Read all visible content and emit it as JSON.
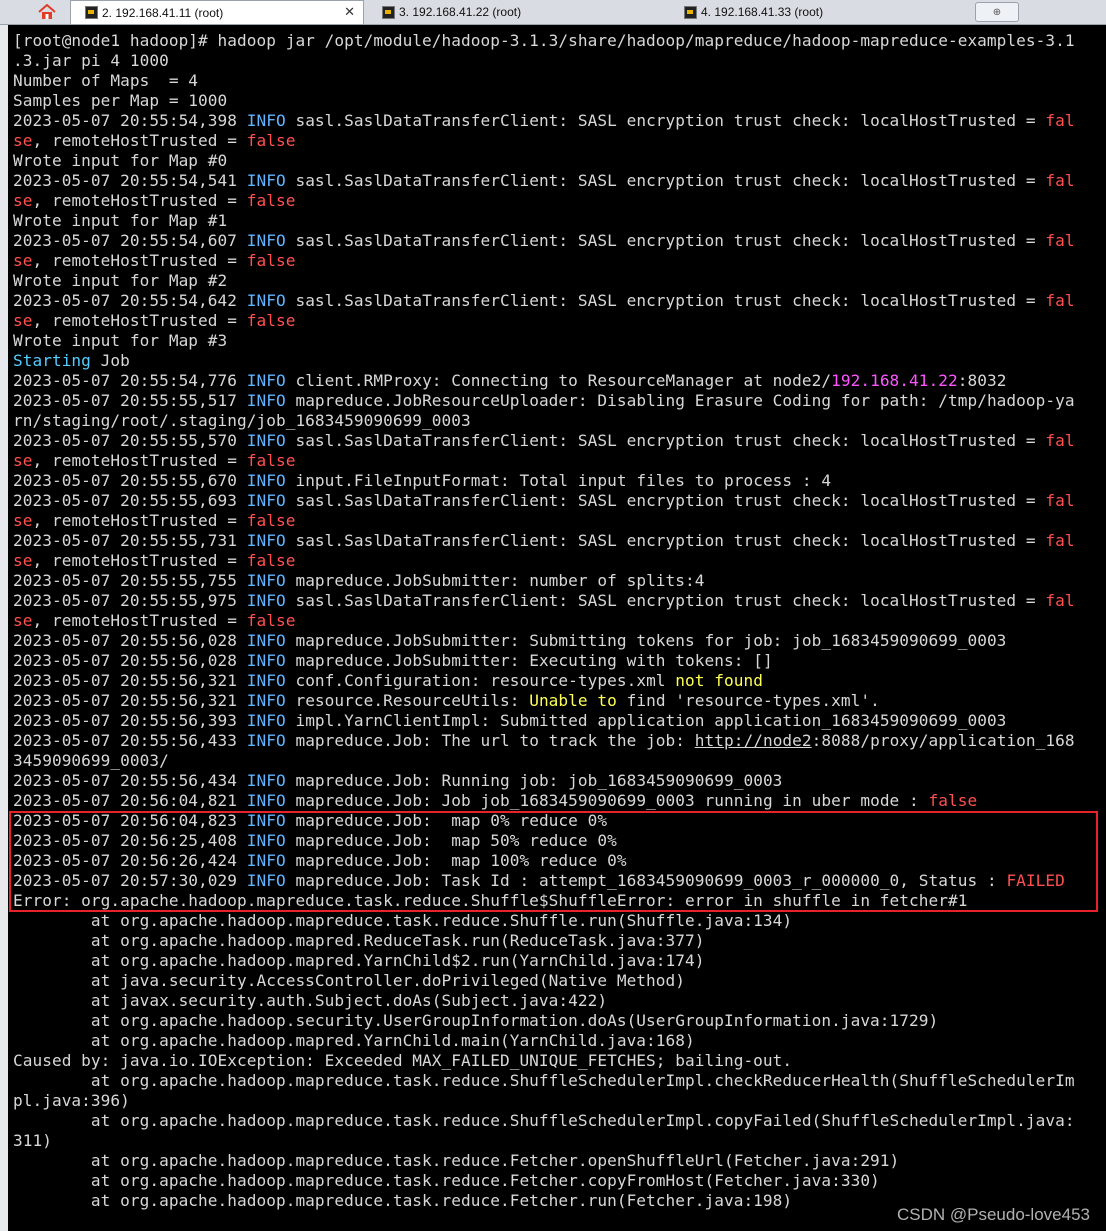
{
  "tabs": [
    {
      "label": "2. 192.168.41.11 (root)",
      "active": true,
      "closable": true
    },
    {
      "label": "3. 192.168.41.22 (root)",
      "active": false,
      "closable": false
    },
    {
      "label": "4. 192.168.41.33 (root)",
      "active": false,
      "closable": false
    }
  ],
  "icons": {
    "home": "home-icon",
    "new_tab": "new-tab-icon",
    "tab": "terminal-tab-icon"
  },
  "colors": {
    "background": "#000000",
    "text": "#d8d8d8",
    "info": "#5fb3ff",
    "false": "#ff4f4f",
    "ip": "#ff55ff",
    "warning": "#ffff55",
    "highlight_box": "#e8222a"
  },
  "terminal_lines": [
    [
      {
        "t": "[root@node1 hadoop]# hadoop jar /opt/module/hadoop-3.1.3/share/hadoop/mapreduce/hadoop-mapreduce-examples-3.1"
      }
    ],
    [
      {
        "t": ".3.jar pi 4 1000"
      }
    ],
    [
      {
        "t": "Number of Maps  = 4"
      }
    ],
    [
      {
        "t": "Samples per Map = 1000"
      }
    ],
    [
      {
        "t": "2023-05-07 20:55:54,398 "
      },
      {
        "t": "INFO",
        "c": "info"
      },
      {
        "t": " sasl.SaslDataTransferClient: SASL encryption trust check: localHostTrusted = "
      },
      {
        "t": "fal",
        "c": "red"
      }
    ],
    [
      {
        "t": "se",
        "c": "red"
      },
      {
        "t": ", remoteHostTrusted = "
      },
      {
        "t": "false",
        "c": "red"
      }
    ],
    [
      {
        "t": "Wrote input for Map #0"
      }
    ],
    [
      {
        "t": "2023-05-07 20:55:54,541 "
      },
      {
        "t": "INFO",
        "c": "info"
      },
      {
        "t": " sasl.SaslDataTransferClient: SASL encryption trust check: localHostTrusted = "
      },
      {
        "t": "fal",
        "c": "red"
      }
    ],
    [
      {
        "t": "se",
        "c": "red"
      },
      {
        "t": ", remoteHostTrusted = "
      },
      {
        "t": "false",
        "c": "red"
      }
    ],
    [
      {
        "t": "Wrote input for Map #1"
      }
    ],
    [
      {
        "t": "2023-05-07 20:55:54,607 "
      },
      {
        "t": "INFO",
        "c": "info"
      },
      {
        "t": " sasl.SaslDataTransferClient: SASL encryption trust check: localHostTrusted = "
      },
      {
        "t": "fal",
        "c": "red"
      }
    ],
    [
      {
        "t": "se",
        "c": "red"
      },
      {
        "t": ", remoteHostTrusted = "
      },
      {
        "t": "false",
        "c": "red"
      }
    ],
    [
      {
        "t": "Wrote input for Map #2"
      }
    ],
    [
      {
        "t": "2023-05-07 20:55:54,642 "
      },
      {
        "t": "INFO",
        "c": "info"
      },
      {
        "t": " sasl.SaslDataTransferClient: SASL encryption trust check: localHostTrusted = "
      },
      {
        "t": "fal",
        "c": "red"
      }
    ],
    [
      {
        "t": "se",
        "c": "red"
      },
      {
        "t": ", remoteHostTrusted = "
      },
      {
        "t": "false",
        "c": "red"
      }
    ],
    [
      {
        "t": "Wrote input for Map #3"
      }
    ],
    [
      {
        "t": "Starting",
        "c": "cyan"
      },
      {
        "t": " Job"
      }
    ],
    [
      {
        "t": "2023-05-07 20:55:54,776 "
      },
      {
        "t": "INFO",
        "c": "info"
      },
      {
        "t": " client.RMProxy: Connecting to ResourceManager at node2/"
      },
      {
        "t": "192.168.41.22",
        "c": "mag"
      },
      {
        "t": ":8032"
      }
    ],
    [
      {
        "t": "2023-05-07 20:55:55,517 "
      },
      {
        "t": "INFO",
        "c": "info"
      },
      {
        "t": " mapreduce.JobResourceUploader: Disabling Erasure Coding for path: /tmp/hadoop-ya"
      }
    ],
    [
      {
        "t": "rn/staging/root/.staging/job_1683459090699_0003"
      }
    ],
    [
      {
        "t": "2023-05-07 20:55:55,570 "
      },
      {
        "t": "INFO",
        "c": "info"
      },
      {
        "t": " sasl.SaslDataTransferClient: SASL encryption trust check: localHostTrusted = "
      },
      {
        "t": "fal",
        "c": "red"
      }
    ],
    [
      {
        "t": "se",
        "c": "red"
      },
      {
        "t": ", remoteHostTrusted = "
      },
      {
        "t": "false",
        "c": "red"
      }
    ],
    [
      {
        "t": "2023-05-07 20:55:55,670 "
      },
      {
        "t": "INFO",
        "c": "info"
      },
      {
        "t": " input.FileInputFormat: Total input files to process : 4"
      }
    ],
    [
      {
        "t": "2023-05-07 20:55:55,693 "
      },
      {
        "t": "INFO",
        "c": "info"
      },
      {
        "t": " sasl.SaslDataTransferClient: SASL encryption trust check: localHostTrusted = "
      },
      {
        "t": "fal",
        "c": "red"
      }
    ],
    [
      {
        "t": "se",
        "c": "red"
      },
      {
        "t": ", remoteHostTrusted = "
      },
      {
        "t": "false",
        "c": "red"
      }
    ],
    [
      {
        "t": "2023-05-07 20:55:55,731 "
      },
      {
        "t": "INFO",
        "c": "info"
      },
      {
        "t": " sasl.SaslDataTransferClient: SASL encryption trust check: localHostTrusted = "
      },
      {
        "t": "fal",
        "c": "red"
      }
    ],
    [
      {
        "t": "se",
        "c": "red"
      },
      {
        "t": ", remoteHostTrusted = "
      },
      {
        "t": "false",
        "c": "red"
      }
    ],
    [
      {
        "t": "2023-05-07 20:55:55,755 "
      },
      {
        "t": "INFO",
        "c": "info"
      },
      {
        "t": " mapreduce.JobSubmitter: number of splits:4"
      }
    ],
    [
      {
        "t": "2023-05-07 20:55:55,975 "
      },
      {
        "t": "INFO",
        "c": "info"
      },
      {
        "t": " sasl.SaslDataTransferClient: SASL encryption trust check: localHostTrusted = "
      },
      {
        "t": "fal",
        "c": "red"
      }
    ],
    [
      {
        "t": "se",
        "c": "red"
      },
      {
        "t": ", remoteHostTrusted = "
      },
      {
        "t": "false",
        "c": "red"
      }
    ],
    [
      {
        "t": "2023-05-07 20:55:56,028 "
      },
      {
        "t": "INFO",
        "c": "info"
      },
      {
        "t": " mapreduce.JobSubmitter: Submitting tokens for job: job_1683459090699_0003"
      }
    ],
    [
      {
        "t": "2023-05-07 20:55:56,028 "
      },
      {
        "t": "INFO",
        "c": "info"
      },
      {
        "t": " mapreduce.JobSubmitter: Executing with tokens: []"
      }
    ],
    [
      {
        "t": "2023-05-07 20:55:56,321 "
      },
      {
        "t": "INFO",
        "c": "info"
      },
      {
        "t": " conf.Configuration: resource-types.xml "
      },
      {
        "t": "not found",
        "c": "yel"
      }
    ],
    [
      {
        "t": "2023-05-07 20:55:56,321 "
      },
      {
        "t": "INFO",
        "c": "info"
      },
      {
        "t": " resource.ResourceUtils: "
      },
      {
        "t": "Unable to",
        "c": "yel"
      },
      {
        "t": " find 'resource-types.xml'."
      }
    ],
    [
      {
        "t": "2023-05-07 20:55:56,393 "
      },
      {
        "t": "INFO",
        "c": "info"
      },
      {
        "t": " impl.YarnClientImpl: Submitted application application_1683459090699_0003"
      }
    ],
    [
      {
        "t": "2023-05-07 20:55:56,433 "
      },
      {
        "t": "INFO",
        "c": "info"
      },
      {
        "t": " mapreduce.Job: The url to track the job: "
      },
      {
        "t": "http://node2",
        "c": "u"
      },
      {
        "t": ":8088/proxy/application_168"
      }
    ],
    [
      {
        "t": "3459090699_0003/"
      }
    ],
    [
      {
        "t": "2023-05-07 20:55:56,434 "
      },
      {
        "t": "INFO",
        "c": "info"
      },
      {
        "t": " mapreduce.Job: Running job: job_1683459090699_0003"
      }
    ],
    [
      {
        "t": "2023-05-07 20:56:04,821 "
      },
      {
        "t": "INFO",
        "c": "info"
      },
      {
        "t": " mapreduce.Job: Job job_1683459090699_0003 running in uber mode : "
      },
      {
        "t": "false",
        "c": "red"
      }
    ],
    [
      {
        "t": "2023-05-07 20:56:04,823 "
      },
      {
        "t": "INFO",
        "c": "info"
      },
      {
        "t": " mapreduce.Job:  map 0% reduce 0%"
      }
    ],
    [
      {
        "t": "2023-05-07 20:56:25,408 "
      },
      {
        "t": "INFO",
        "c": "info"
      },
      {
        "t": " mapreduce.Job:  map 50% reduce 0%"
      }
    ],
    [
      {
        "t": "2023-05-07 20:56:26,424 "
      },
      {
        "t": "INFO",
        "c": "info"
      },
      {
        "t": " mapreduce.Job:  map 100% reduce 0%"
      }
    ],
    [
      {
        "t": "2023-05-07 20:57:30,029 "
      },
      {
        "t": "INFO",
        "c": "info"
      },
      {
        "t": " mapreduce.Job: Task Id : attempt_1683459090699_0003_r_000000_0, Status : "
      },
      {
        "t": "FAILED",
        "c": "red"
      }
    ],
    [
      {
        "t": "Error: org.apache.hadoop.mapreduce.task.reduce.Shuffle$ShuffleError: error in shuffle in fetcher#1"
      }
    ],
    [
      {
        "t": "        at org.apache.hadoop.mapreduce.task.reduce.Shuffle.run(Shuffle.java:134)"
      }
    ],
    [
      {
        "t": "        at org.apache.hadoop.mapred.ReduceTask.run(ReduceTask.java:377)"
      }
    ],
    [
      {
        "t": "        at org.apache.hadoop.mapred.YarnChild$2.run(YarnChild.java:174)"
      }
    ],
    [
      {
        "t": "        at java.security.AccessController.doPrivileged(Native Method)"
      }
    ],
    [
      {
        "t": "        at javax.security.auth.Subject.doAs(Subject.java:422)"
      }
    ],
    [
      {
        "t": "        at org.apache.hadoop.security.UserGroupInformation.doAs(UserGroupInformation.java:1729)"
      }
    ],
    [
      {
        "t": "        at org.apache.hadoop.mapred.YarnChild.main(YarnChild.java:168)"
      }
    ],
    [
      {
        "t": "Caused by: java.io.IOException: Exceeded MAX_FAILED_UNIQUE_FETCHES; bailing-out."
      }
    ],
    [
      {
        "t": "        at org.apache.hadoop.mapreduce.task.reduce.ShuffleSchedulerImpl.checkReducerHealth(ShuffleSchedulerIm"
      }
    ],
    [
      {
        "t": "pl.java:396)"
      }
    ],
    [
      {
        "t": "        at org.apache.hadoop.mapreduce.task.reduce.ShuffleSchedulerImpl.copyFailed(ShuffleSchedulerImpl.java:"
      }
    ],
    [
      {
        "t": "311)"
      }
    ],
    [
      {
        "t": "        at org.apache.hadoop.mapreduce.task.reduce.Fetcher.openShuffleUrl(Fetcher.java:291)"
      }
    ],
    [
      {
        "t": "        at org.apache.hadoop.mapreduce.task.reduce.Fetcher.copyFromHost(Fetcher.java:330)"
      }
    ],
    [
      {
        "t": "        at org.apache.hadoop.mapreduce.task.reduce.Fetcher.run(Fetcher.java:198)"
      }
    ]
  ],
  "watermark": "CSDN @Pseudo-love453"
}
